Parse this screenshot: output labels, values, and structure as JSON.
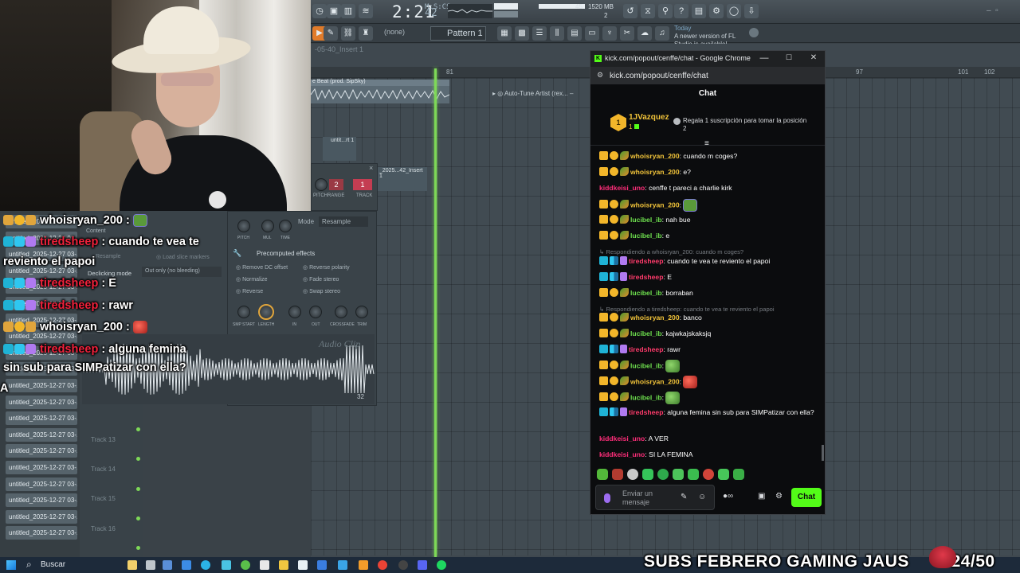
{
  "fl_studio": {
    "time_main": "2:21",
    "time_frac": "42",
    "time_unit_label": "M:S:CS",
    "cpu_value": "45",
    "mem_value": "1520 MB",
    "cpu_count": "2",
    "pattern_label": "Pattern 1",
    "none_label": "(none)",
    "news_today": "Today",
    "news_text": "A newer version of FL Studio is available!",
    "playlist_title": "-05-40_Insert 1",
    "clip_label": "e Beat (prod. SipSky)",
    "clip2_label": "untit...rt 1",
    "clip3_label": "_2025...42_Insert 1",
    "autotune_label": "Auto-Tune Artist (rex...",
    "ruler_labels": [
      "81",
      "97",
      "101",
      "102"
    ],
    "tracks": [
      "Track 13",
      "Track 14",
      "Track 15",
      "Track 16"
    ],
    "sampler": {
      "pitch_value": "2",
      "track_value": "1",
      "pitch_label": "PITCH",
      "range_label": "RANGE",
      "track_label": "TRACK",
      "mode_label": "Mode",
      "mode_value": "Resample",
      "content_label": "Content",
      "resample_label": "Resample",
      "load_slice": "Load slice markers",
      "knob_labels": [
        "PITCH",
        "MUL",
        "TIME"
      ],
      "precomputed": "Precomputed effects",
      "opt_remove_dc": "Remove DC offset",
      "opt_reverse_polarity": "Reverse polarity",
      "opt_normalize": "Normalize",
      "opt_fade_stereo": "Fade stereo",
      "opt_reverse": "Reverse",
      "opt_swap_stereo": "Swap stereo",
      "declicking_label": "Declicking mode",
      "declicking_value": "Out only (no bleeding)",
      "bottom_knobs": [
        "SMP START",
        "LENGTH",
        "IN",
        "OUT",
        "CROSSFADE",
        "TRIM"
      ],
      "audio_clip_label": "Audio Clip",
      "zoom_value": "32"
    },
    "files": [
      "untitled_2025-12-27 03-...",
      "untitled_2025-12-27 03-...",
      "untitled_2025-12-27 03-...",
      "untitled_2025-12-27 03-...",
      "untitled_2025-12-27 03-...",
      "untitled_2025-12-27 03-...",
      "untitled_2025-12-27 03-...",
      "untitled_2025-12-27 03-...",
      "untitled_2025-12-27 03-...",
      "untitled_2025-12-27 03-...",
      "untitled_2025-12-27 03-...",
      "untitled_2025-12-27 03-...",
      "untitled_2025-12-27 03-...",
      "untitled_2025-12-27 03-...",
      "untitled_2025-12-27 03-...",
      "untitled_2025-12-27 03-...",
      "untitled_2025-12-27 03-...",
      "untitled_2025-12-27 03-...",
      "untitled_2025-12-27 03-...",
      "untitled_2025-12-27 03-..."
    ]
  },
  "overlay": {
    "lines": [
      {
        "user": "whoisryan_200",
        "text": ":"
      },
      {
        "user": "tiredsheep",
        "text": ": cuando te vea te"
      },
      {
        "user": "",
        "text": "reviento el papoi"
      },
      {
        "user": "tiredsheep",
        "text": ": E"
      },
      {
        "user": "tiredsheep",
        "text": ": rawr"
      },
      {
        "user": "whoisryan_200",
        "text": ":"
      },
      {
        "user": "tiredsheep",
        "text": ": alguna femina"
      },
      {
        "user": "",
        "text": "sin sub para SIMPatizar con ella?"
      },
      {
        "user": "",
        "text": "A"
      }
    ]
  },
  "chrome": {
    "title": "kick.com/popout/cenffe/chat - Google Chrome",
    "url": "kick.com/popout/cenffe/chat",
    "minimize": "—",
    "maximize": "☐",
    "close": "✕"
  },
  "chat": {
    "header": "Chat",
    "pinned": {
      "medal": "1",
      "user": "1JVazquez",
      "count": "1",
      "text": "Regala 1 suscripción para tomar la posición 2"
    },
    "messages": [
      {
        "user": "whoisryan_200",
        "text": "cuando m coges?"
      },
      {
        "user": "whoisryan_200",
        "text": "e?"
      },
      {
        "user": "kiddkeisi_uno",
        "text": "cenffe t pareci a charlie kirk"
      },
      {
        "user": "whoisryan_200",
        "text": ""
      },
      {
        "user": "lucibel_ib",
        "text": "nah bue"
      },
      {
        "user": "lucibel_ib",
        "text": "e"
      },
      {
        "reply": "Respondiendo a whoisryan_200: cuando m coges?"
      },
      {
        "user": "tiredsheep",
        "text": "cuando te vea te reviento el papoi"
      },
      {
        "user": "tiredsheep",
        "text": "E"
      },
      {
        "user": "lucibel_ib",
        "text": "borraban"
      },
      {
        "reply": "Respondiendo a tiredsheep: cuando te vea te reviento el papoi"
      },
      {
        "user": "whoisryan_200",
        "text": "banco"
      },
      {
        "user": "lucibel_ib",
        "text": "kajwkajskaksjq"
      },
      {
        "user": "tiredsheep",
        "text": "rawr"
      },
      {
        "user": "lucibel_ib",
        "text": ""
      },
      {
        "user": "whoisryan_200",
        "text": ""
      },
      {
        "user": "lucibel_ib",
        "text": ""
      },
      {
        "user": "tiredsheep",
        "text": "alguna femina sin sub para SIMPatizar con ella?"
      },
      {
        "user": "kiddkeisi_uno",
        "text": "A VER"
      },
      {
        "user": "kiddkeisi_uno",
        "text": "SI LA FEMINA"
      }
    ],
    "input_placeholder": "Enviar un mensaje",
    "send_label": "Chat"
  },
  "taskbar": {
    "search_label": "Buscar"
  },
  "banner": {
    "text": "SUBS FEBRERO GAMING JAUS",
    "count": "24/50"
  },
  "colors": {
    "kick_green": "#53fc18",
    "gold_user": "#f2c43a",
    "pink_user": "#ff3b6b",
    "green_user": "#6ee04e"
  }
}
